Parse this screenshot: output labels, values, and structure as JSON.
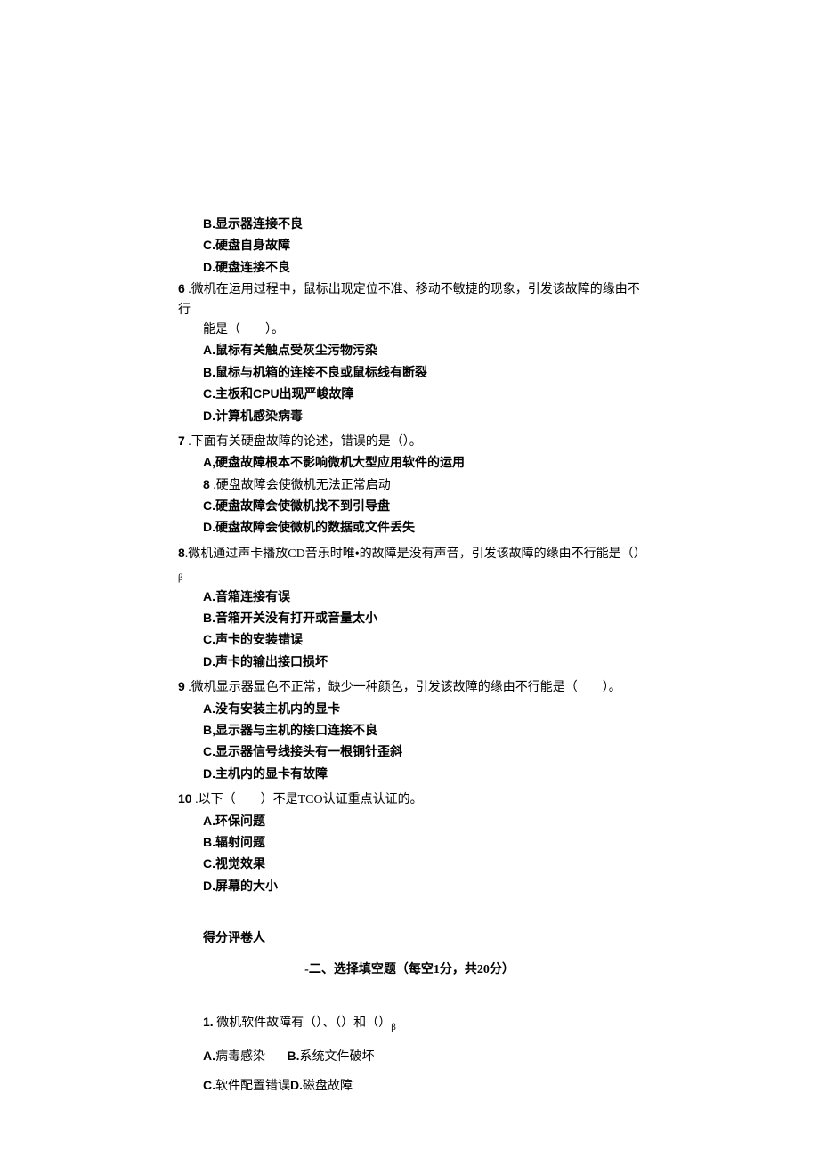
{
  "frag": {
    "b": "B.显示器连接不良",
    "c": "C.硬盘自身故障",
    "d": "D.硬盘连接不良"
  },
  "q6": {
    "num": "6",
    "stem1": " .微机在运用过程中，鼠标出现定位不准、移动不敏捷的现象，引发该故障的缘由不行",
    "stem2": "能是（　　）。",
    "a": "A.鼠标有关触点受灰尘污物污染",
    "b": "B.鼠标与机箱的连接不良或鼠标线有断裂",
    "c": "C.主板和CPU出现严峻故障",
    "d": "D.计算机感染病毒"
  },
  "q7": {
    "num": "7",
    "stem": " .下面有关硬盘故障的论述，错误的是（）。",
    "a": "A,硬盘故障根本不影响微机大型应用软件的运用",
    "b_num": "8",
    "b_txt": "  .硬盘故障会使微机无法正常启动",
    "c": "C.硬盘故障会使微机找不到引导盘",
    "d": "D.硬盘故障会使微机的数据或文件丢失"
  },
  "q8": {
    "num": "8",
    "stem": ".微机通过声卡播放CD音乐时唯•的故障是没有声音，引发该故障的缘由不行能是（）",
    "sub": "β",
    "a": "A.音箱连接有误",
    "b": "B.音箱开关没有打开或音量太小",
    "c": "C.声卡的安装错误",
    "d": "D.声卡的输出接口损坏"
  },
  "q9": {
    "num": "9",
    "stem": " .微机显示器显色不正常，缺少一种颜色，引发该故障的缘由不行能是（　　）。",
    "a": "A.没有安装主机内的显卡",
    "b": "B,显示器与主机的接口连接不良",
    "c": "C.显示器信号线接头有一根铜针歪斜",
    "d": "D.主机内的显卡有故障"
  },
  "q10": {
    "num": "10",
    "stem": " .以下（　　）不是TCO认证重点认证的。",
    "a": "A.环保问题",
    "b": "B.辐射问题",
    "c": "C.视觉效果",
    "d": "D.屏幕的大小"
  },
  "scorer": "得分评卷人",
  "section2": "-二、选择填空题（每空1分，共20分）",
  "fill1": {
    "num": "1.",
    "stem": "微机软件故障有（）、（）和（）",
    "sub": "β",
    "a_lbl": "A.",
    "a_txt": "病毒感染",
    "b_lbl": "B.",
    "b_txt": "系统文件破坏",
    "c_lbl": "C.",
    "c_txt": "软件配置错误",
    "d_lbl": "D.",
    "d_txt": "磁盘故障"
  }
}
